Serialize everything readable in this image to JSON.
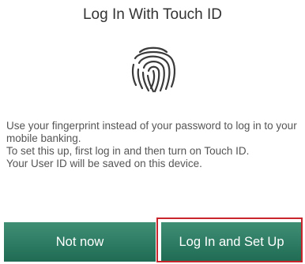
{
  "dialog": {
    "title": "Log In With Touch ID",
    "icon": "fingerprint-icon",
    "body_lines": [
      "Use your fingerprint instead of your password to log in to your mobile banking.",
      "To set this up, first log in and then turn on Touch ID.",
      "Your User ID will be saved on this device."
    ],
    "buttons": {
      "not_now": "Not now",
      "setup": "Log In and Set Up"
    }
  },
  "colors": {
    "button_top": "#3f8f75",
    "button_bottom": "#1f6b53",
    "highlight": "#c9252c"
  }
}
